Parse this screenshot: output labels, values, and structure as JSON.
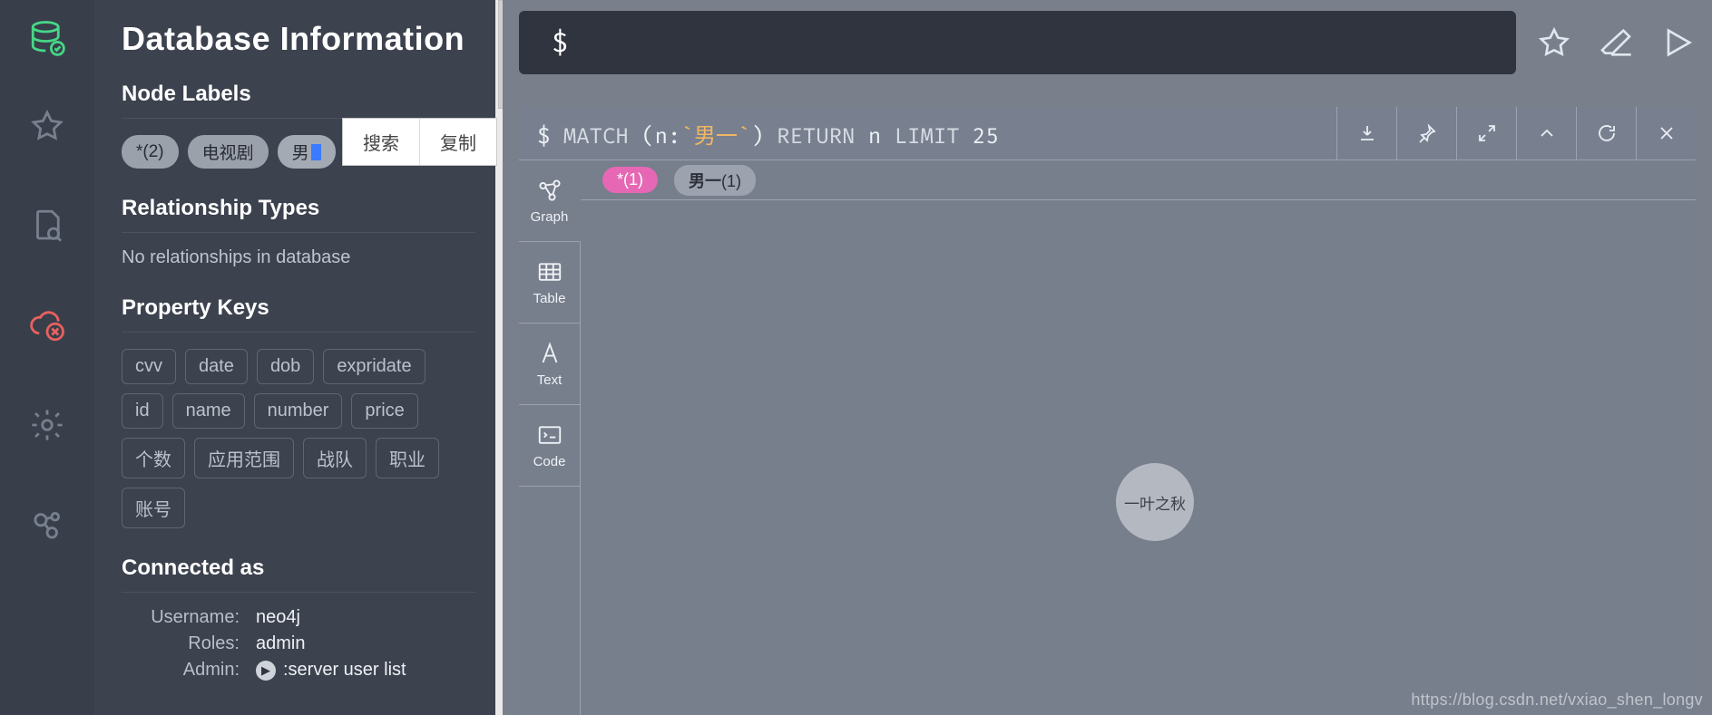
{
  "sidebar": {
    "title": "Database Information",
    "sections": {
      "node_labels_h": "Node Labels",
      "rel_types_h": "Relationship Types",
      "rel_types_empty": "No relationships in database",
      "prop_keys_h": "Property Keys",
      "connected_h": "Connected as"
    },
    "labels": {
      "all": "*(2)",
      "tv": "电视剧",
      "man": "男"
    },
    "props": [
      "cvv",
      "date",
      "dob",
      "expridate",
      "id",
      "name",
      "number",
      "price",
      "个数",
      "应用范围",
      "战队",
      "职业",
      "账号"
    ],
    "conn": {
      "username_k": "Username:",
      "username_v": "neo4j",
      "roles_k": "Roles:",
      "roles_v": "admin",
      "admin_k": "Admin:",
      "admin_v": ":server user list"
    },
    "popup": {
      "search": "搜索",
      "copy": "复制"
    }
  },
  "editor": {
    "prompt": "$"
  },
  "result": {
    "cmd_prefix": "$ ",
    "cmd_match": "MATCH",
    "cmd_open": " (n:",
    "cmd_label": "`男一`",
    "cmd_close": ") ",
    "cmd_return": "RETURN",
    "cmd_mid": " n ",
    "cmd_limit": "LIMIT",
    "cmd_tail": " 25",
    "views": {
      "graph": "Graph",
      "table": "Table",
      "text": "Text",
      "code": "Code"
    },
    "legend": {
      "all": "*(1)",
      "man_prefix": "男一",
      "man_count": "(1)"
    },
    "node_label": "一叶之秋"
  },
  "watermark": "https://blog.csdn.net/vxiao_shen_longv"
}
